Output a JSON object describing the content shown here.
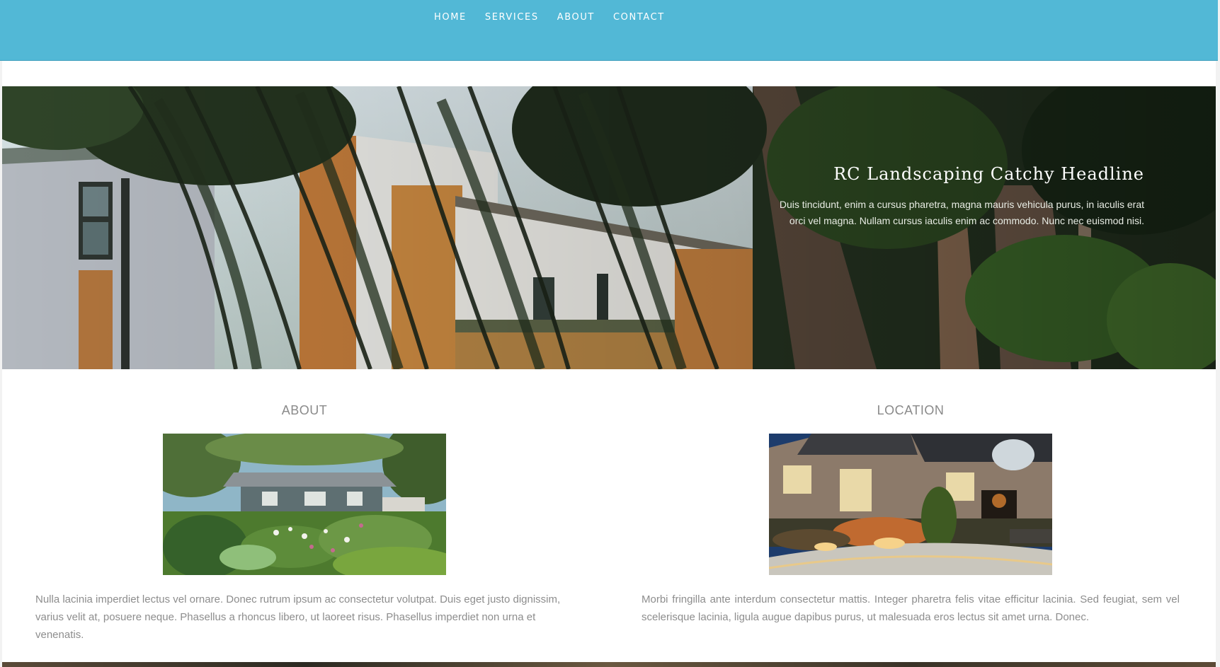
{
  "nav": {
    "items": [
      {
        "label": "HOME"
      },
      {
        "label": "SERVICES"
      },
      {
        "label": "ABOUT"
      },
      {
        "label": "CONTACT"
      }
    ]
  },
  "hero": {
    "title": "RC Landscaping Catchy Headline",
    "body": "Duis tincidunt, enim a cursus pharetra, magna mauris vehicula purus, in iaculis erat orci vel magna. Nullam cursus iaculis enim ac commodo. Nunc nec euismod nisi."
  },
  "about": {
    "heading": "ABOUT",
    "text": "Nulla lacinia imperdiet lectus vel ornare. Donec rutrum ipsum ac consectetur volutpat. Duis eget justo dignissim, varius velit at, posuere neque. Phasellus a rhoncus libero, ut laoreet risus. Phasellus imperdiet non urna et venenatis."
  },
  "location": {
    "heading": "LOCATION",
    "text": "Morbi fringilla ante interdum consectetur mattis. Integer pharetra felis vitae efficitur lacinia. Sed feugiat, sem vel scelerisque lacinia, ligula augue dapibus purus, ut malesuada eros lectus sit amet urna. Donec."
  },
  "colors": {
    "nav_background": "#52b8d6",
    "nav_text": "#ffffff",
    "heading_text": "#8a8a8a",
    "body_text": "#8d8d8d"
  }
}
